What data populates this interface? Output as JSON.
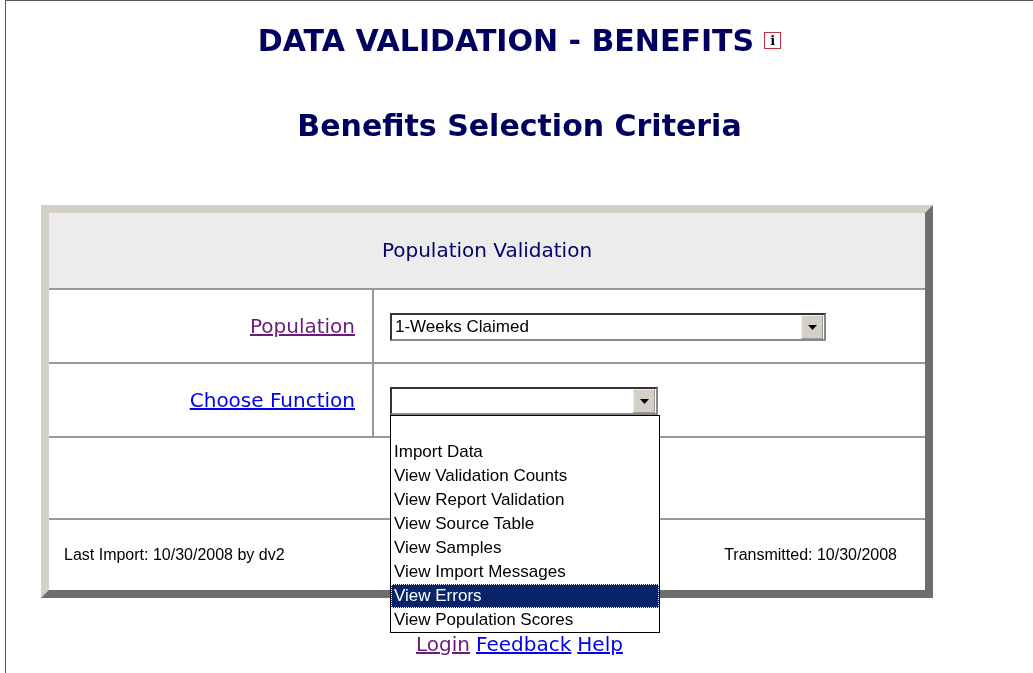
{
  "title": "DATA VALIDATION - BENEFITS",
  "info_icon": "i",
  "subtitle": "Benefits Selection Criteria",
  "panel": {
    "heading": "Population Validation",
    "fields": [
      {
        "label": "Population",
        "visited": true,
        "value": "1-Weeks Claimed",
        "expanded": false
      },
      {
        "label": "Choose Function",
        "visited": false,
        "expanded": true
      }
    ],
    "last_import": "Last Import: 10/30/2008 by dv2",
    "transmitted": "Transmitted: 10/30/2008"
  },
  "dropdown_options": [
    {
      "label": "Import Data",
      "selected": false
    },
    {
      "label": "View Validation Counts",
      "selected": false
    },
    {
      "label": "View Report Validation",
      "selected": false
    },
    {
      "label": "View Source Table",
      "selected": false
    },
    {
      "label": "View Samples",
      "selected": false
    },
    {
      "label": "View Import Messages",
      "selected": false
    },
    {
      "label": "View Errors",
      "selected": true
    },
    {
      "label": "View Population Scores",
      "selected": false
    }
  ],
  "footer_links": [
    {
      "label": "Login",
      "visited": true
    },
    {
      "label": "Feedback",
      "visited": false
    },
    {
      "label": "Help",
      "visited": false
    }
  ]
}
